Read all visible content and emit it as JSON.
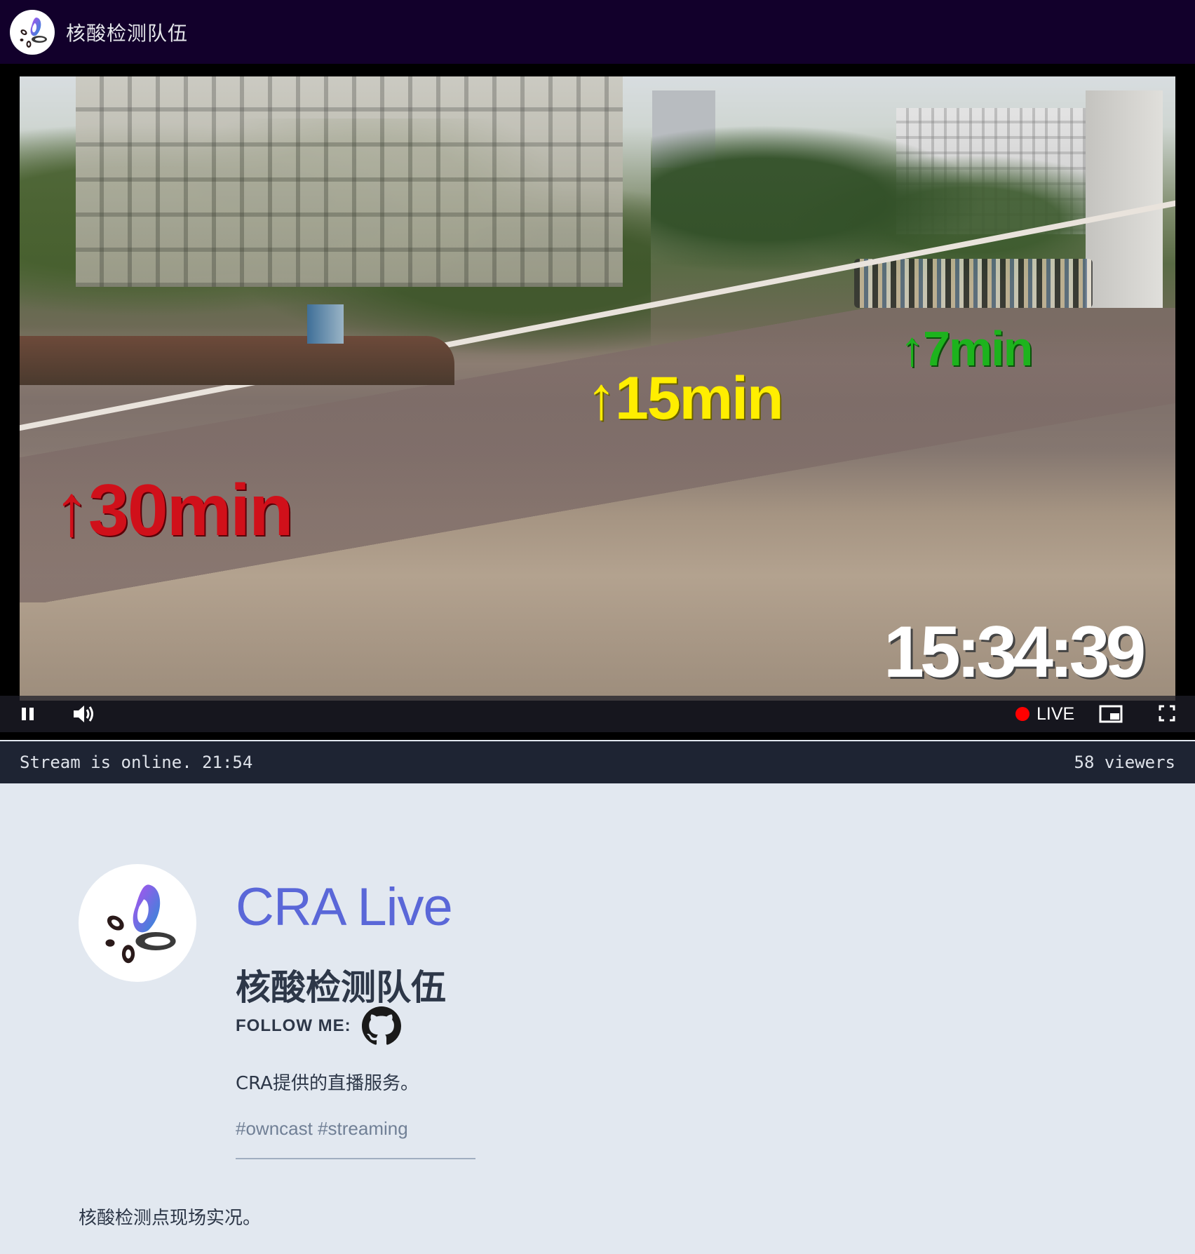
{
  "header": {
    "title": "核酸检测队伍",
    "logo_icon": "owncast-logo-icon"
  },
  "player": {
    "overlays": {
      "wait_30": "↑30min",
      "wait_15": "↑15min",
      "wait_7": "↑7min",
      "clock": "15:34:39"
    },
    "controls": {
      "pause_icon": "pause-icon",
      "volume_icon": "volume-icon",
      "live_label": "LIVE",
      "pip_icon": "picture-in-picture-icon",
      "fullscreen_icon": "fullscreen-icon"
    },
    "colors": {
      "wait_30": "#d0101a",
      "wait_15": "#ffee00",
      "wait_7": "#1db31d",
      "live_dot": "#ff0000"
    }
  },
  "status": {
    "text": "Stream is online. 21:54",
    "viewers": "58 viewers"
  },
  "profile": {
    "site_name": "CRA Live",
    "stream_title": "核酸检测队伍",
    "follow_label": "FOLLOW ME:",
    "social_icon": "github-icon",
    "summary": "CRA提供的直播服务。",
    "tags": "#owncast #streaming",
    "extra": "核酸检测点现场实况。"
  },
  "colors": {
    "header_bg": "#12002b",
    "accent": "#5a67d8",
    "status_bar_bg": "#1e2433",
    "page_bg": "#e2e8f0"
  }
}
